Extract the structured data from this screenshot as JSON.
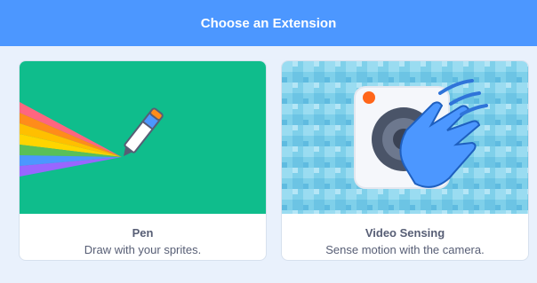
{
  "header": {
    "title": "Choose an Extension"
  },
  "extensions": [
    {
      "title": "Pen",
      "description": "Draw with your sprites.",
      "icon": "pen-icon",
      "bg_color": "#0fbd8c"
    },
    {
      "title": "Video Sensing",
      "description": "Sense motion with the camera.",
      "icon": "camera-hand-icon",
      "bg_color": "#81d3ee"
    }
  ],
  "colors": {
    "header_bg": "#4c97ff",
    "page_bg": "#e9f1fc",
    "text": "#575e75"
  }
}
